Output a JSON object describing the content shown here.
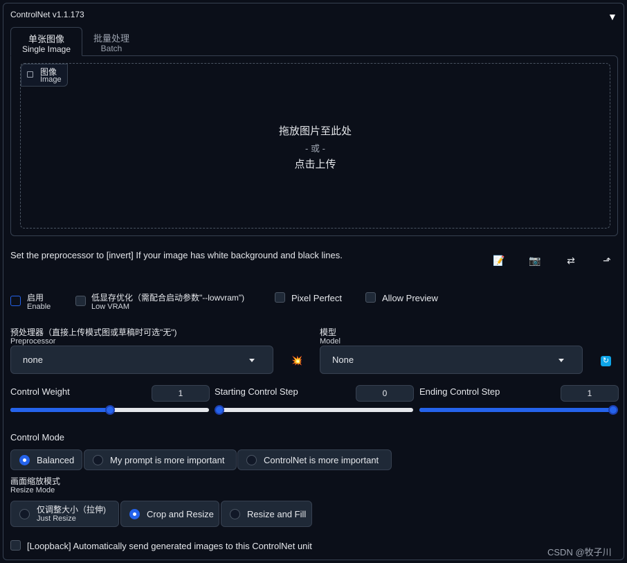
{
  "panel": {
    "title": "ControlNet v1.1.173",
    "collapse_icon": "▼"
  },
  "tabs": [
    {
      "cn": "单张图像",
      "en": "Single Image"
    },
    {
      "cn": "批量处理",
      "en": "Batch"
    }
  ],
  "image": {
    "label_cn": "图像",
    "label_en": "Image",
    "drop_line1": "拖放图片至此处",
    "drop_line2": "- 或 -",
    "drop_line3": "点击上传"
  },
  "hint": "Set the preprocessor to [invert] If your image has white background and black lines.",
  "tools": [
    "edit-icon",
    "camera-icon",
    "swap-icon",
    "send-icon"
  ],
  "checkboxes": {
    "enable": {
      "cn": "启用",
      "en": "Enable"
    },
    "lowvram": {
      "cn": "低显存优化（需配合启动参数\"--lowvram\")",
      "en": "Low VRAM"
    },
    "pixel_perfect": "Pixel Perfect",
    "allow_preview": "Allow Preview"
  },
  "preprocessor": {
    "label_cn": "预处理器（直接上传模式图或草稿时可选\"无\")",
    "label_en": "Preprocessor",
    "value": "none"
  },
  "model": {
    "label_cn": "模型",
    "label_en": "Model",
    "value": "None"
  },
  "sliders": {
    "weight": {
      "label": "Control Weight",
      "value": "1",
      "fraction": 0.5
    },
    "start": {
      "label": "Starting Control Step",
      "value": "0",
      "fraction": 0.0
    },
    "end": {
      "label": "Ending Control Step",
      "value": "1",
      "fraction": 1.0
    }
  },
  "control_mode": {
    "label": "Control Mode",
    "options": [
      "Balanced",
      "My prompt is more important",
      "ControlNet is more important"
    ],
    "selected": "Balanced"
  },
  "resize_mode": {
    "label_cn": "画面缩放模式",
    "label_en": "Resize Mode",
    "options": [
      {
        "cn": "仅调整大小（拉伸)",
        "en": "Just Resize"
      },
      {
        "label": "Crop and Resize"
      },
      {
        "label": "Resize and Fill"
      }
    ],
    "selected": "Crop and Resize"
  },
  "loopback": "[Loopback] Automatically send generated images to this ControlNet unit",
  "watermark": "CSDN @牧子川",
  "colors": {
    "accent": "#2563eb",
    "background": "#0b0f19",
    "surface": "#1f2937",
    "border": "#374151"
  }
}
